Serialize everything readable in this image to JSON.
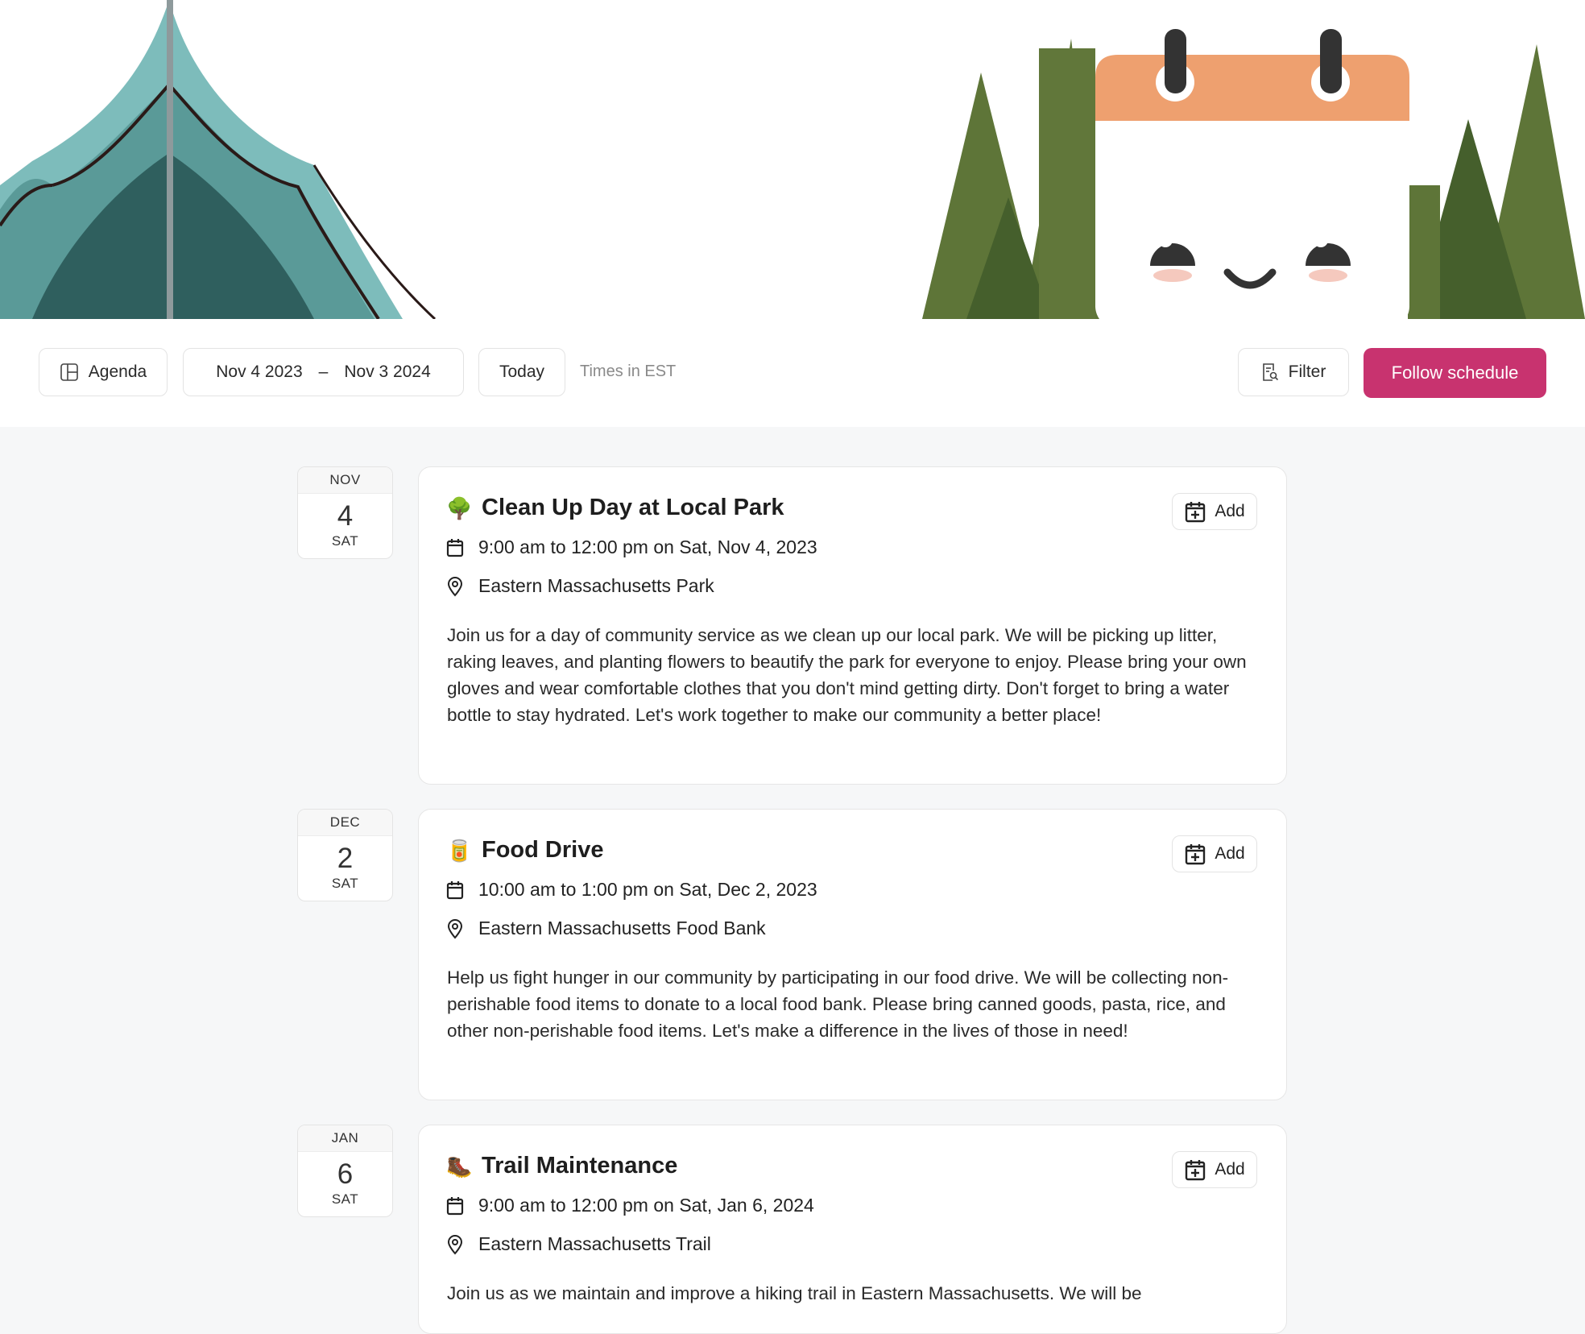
{
  "toolbar": {
    "agenda_label": "Agenda",
    "range_start": "Nov 4 2023",
    "range_separator": "–",
    "range_end": "Nov 3 2024",
    "today_label": "Today",
    "timezone_note": "Times in EST",
    "filter_label": "Filter",
    "follow_label": "Follow schedule"
  },
  "colors": {
    "accent": "#c8336f",
    "calendar_header": "#eea06f",
    "tree_green": "#5e7538",
    "tent_teal": "#7dbcbb"
  },
  "events": [
    {
      "month": "NOV",
      "day": "4",
      "weekday": "SAT",
      "emoji": "🌳",
      "icon": "tree-emoji-icon",
      "title": "Clean Up Day at Local Park",
      "time": "9:00 am to 12:00 pm on Sat, Nov 4, 2023",
      "location": "Eastern Massachusetts Park",
      "description": "Join us for a day of community service as we clean up our local park. We will be picking up litter, raking leaves, and planting flowers to beautify the park for everyone to enjoy. Please bring your own gloves and wear comfortable clothes that you don't mind getting dirty. Don't forget to bring a water bottle to stay hydrated. Let's work together to make our community a better place!",
      "add_label": "Add"
    },
    {
      "month": "DEC",
      "day": "2",
      "weekday": "SAT",
      "emoji": "🥫",
      "icon": "canned-food-emoji-icon",
      "title": "Food Drive",
      "time": "10:00 am to 1:00 pm on Sat, Dec 2, 2023",
      "location": "Eastern Massachusetts Food Bank",
      "description": "Help us fight hunger in our community by participating in our food drive. We will be collecting non-perishable food items to donate to a local food bank. Please bring canned goods, pasta, rice, and other non-perishable food items. Let's make a difference in the lives of those in need!",
      "add_label": "Add"
    },
    {
      "month": "JAN",
      "day": "6",
      "weekday": "SAT",
      "emoji": "🥾",
      "icon": "hiking-boot-emoji-icon",
      "title": "Trail Maintenance",
      "time": "9:00 am to 12:00 pm on Sat, Jan 6, 2024",
      "location": "Eastern Massachusetts Trail",
      "description": "Join us as we maintain and improve a hiking trail in Eastern Massachusetts. We will be",
      "add_label": "Add"
    }
  ]
}
